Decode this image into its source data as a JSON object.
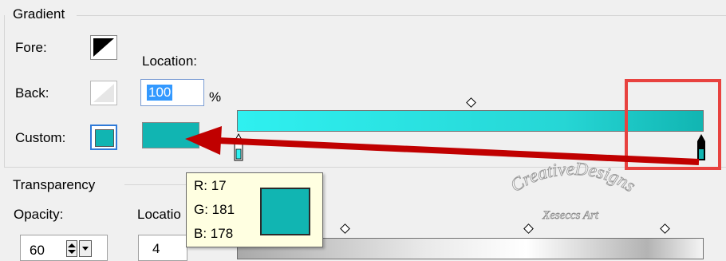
{
  "gradient": {
    "group_title": "Gradient",
    "fore_label": "Fore:",
    "back_label": "Back:",
    "custom_label": "Custom:",
    "location_label": "Location:",
    "location_value": "100",
    "percent_sign": "%",
    "custom_color": "#11b5b2",
    "bar_start_color": "#2ff0f0",
    "bar_end_color": "#11b5b2",
    "location_fraction": 1.0
  },
  "transparency": {
    "group_title": "Transparency",
    "opacity_label": "Opacity:",
    "opacity_value": "60",
    "location_label": "Locatio",
    "location_value": "4"
  },
  "tooltip": {
    "r": "R: 17",
    "g": "G: 181",
    "b": "B: 178",
    "color": "#11b5b2"
  },
  "annotation": {
    "arrow_color": "#c00000",
    "highlight_box_color": "#e8423f"
  },
  "watermark": {
    "text": "CreativeDesigns",
    "subtext": "Xeseccs Art"
  }
}
